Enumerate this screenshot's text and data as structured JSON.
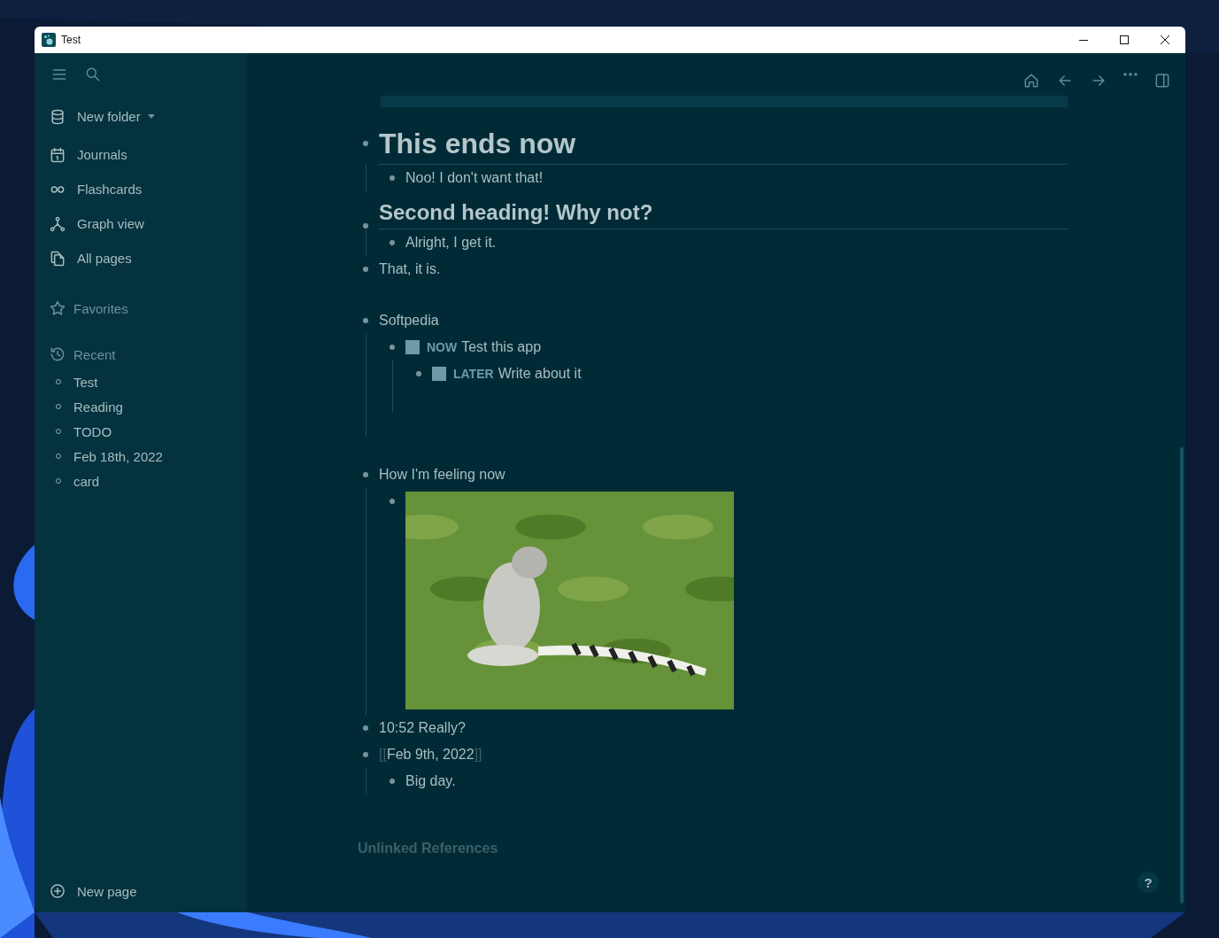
{
  "window": {
    "title": "Test"
  },
  "sidebar": {
    "nav": [
      {
        "label": "New folder",
        "kind": "dropdown"
      },
      {
        "label": "Journals",
        "kind": "journals"
      },
      {
        "label": "Flashcards",
        "kind": "flashcards"
      },
      {
        "label": "Graph view",
        "kind": "graph"
      },
      {
        "label": "All pages",
        "kind": "pages"
      }
    ],
    "favorites": {
      "label": "Favorites"
    },
    "recent": {
      "label": "Recent",
      "items": [
        "Test",
        "Reading",
        "TODO",
        "Feb 18th, 2022",
        "card"
      ]
    },
    "new_page": "New page"
  },
  "blocks": [
    {
      "kind": "heading1",
      "text": "This ends now",
      "children": [
        {
          "kind": "text",
          "text": "Noo! I don't want that!"
        }
      ]
    },
    {
      "kind": "heading2",
      "text": "Second heading! Why not?",
      "children": [
        {
          "kind": "text",
          "text": "Alright, I get it."
        }
      ]
    },
    {
      "kind": "text",
      "text": "That, it is."
    },
    {
      "kind": "empty"
    },
    {
      "kind": "text",
      "text": "Softpedia",
      "children": [
        {
          "kind": "todo",
          "marker": "NOW",
          "text": "Test this app",
          "checked": false,
          "children": [
            {
              "kind": "todo",
              "marker": "LATER",
              "text": "Write about it",
              "checked": false
            },
            {
              "kind": "empty"
            }
          ]
        },
        {
          "kind": "empty"
        }
      ]
    },
    {
      "kind": "empty"
    },
    {
      "kind": "text",
      "text": "How I'm feeling now"
    },
    {
      "kind": "text",
      "text": "10:52 Really?"
    },
    {
      "kind": "page-ref",
      "open": "[[",
      "text": "Feb 9th, 2022",
      "close": "]]",
      "children": [
        {
          "kind": "text",
          "text": "Big day."
        }
      ]
    }
  ],
  "unlinked_references": "Unlinked References",
  "help": "?"
}
